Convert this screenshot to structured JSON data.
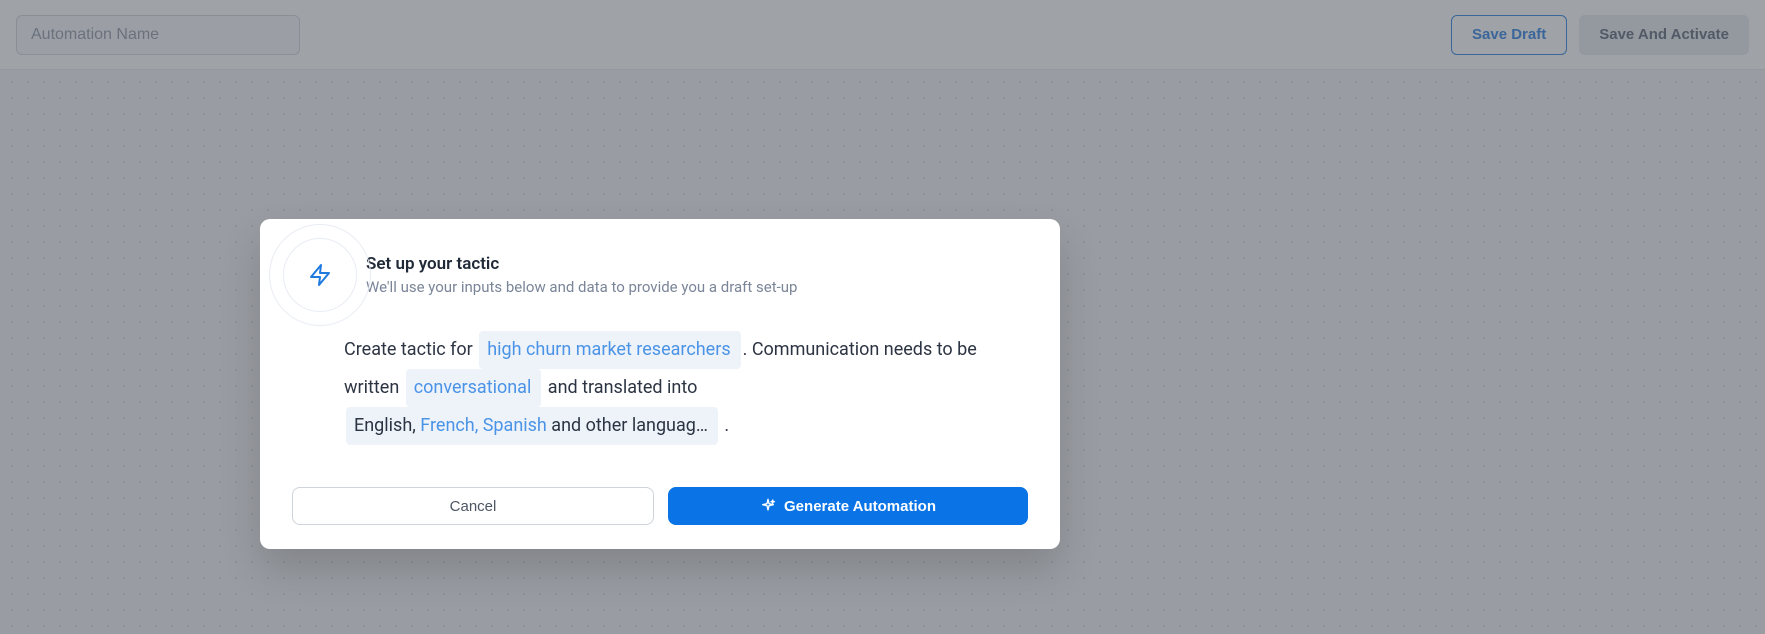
{
  "topbar": {
    "name_placeholder": "Automation Name",
    "save_draft_label": "Save Draft",
    "save_activate_label": "Save And Activate"
  },
  "modal": {
    "title": "Set up your tactic",
    "subtitle": "We'll use your inputs below and data to provide you a draft set-up",
    "body": {
      "text1": "Create tactic for ",
      "chip_audience": "high churn market researchers",
      "text2": ". Communication needs to be written ",
      "chip_tone": "conversational",
      "text3": " and translated into ",
      "chip_lang_prefix_dark": "English, ",
      "chip_lang_highlight": "French, Spanish",
      "chip_lang_suffix_dark": " and other languag…",
      "text4": " ."
    },
    "cancel_label": "Cancel",
    "generate_label": "Generate Automation"
  }
}
